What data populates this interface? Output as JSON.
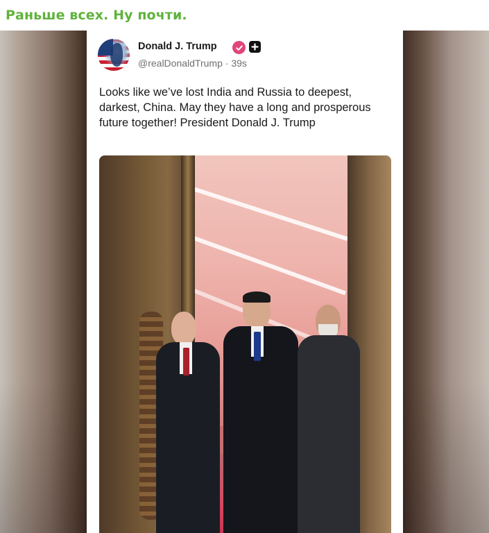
{
  "channel": {
    "title": "Раньше всех. Ну почти.",
    "title_color": "#5fb33c"
  },
  "post": {
    "author": {
      "name": "Donald J. Trump",
      "handle": "@realDonaldTrump",
      "separator": "·",
      "time": "39s",
      "avatar_icon": "flag-portrait-avatar",
      "verified_icon": "verified-check-icon",
      "verified_color": "#e0457b",
      "plus_icon": "plus-badge-icon"
    },
    "text": "Looks like we’ve lost India and Russia to deepest, darkest, China. May they have a long and prosperous future together! President Donald J. Trump",
    "image": {
      "scene": "three-leaders-walking-photo"
    }
  }
}
